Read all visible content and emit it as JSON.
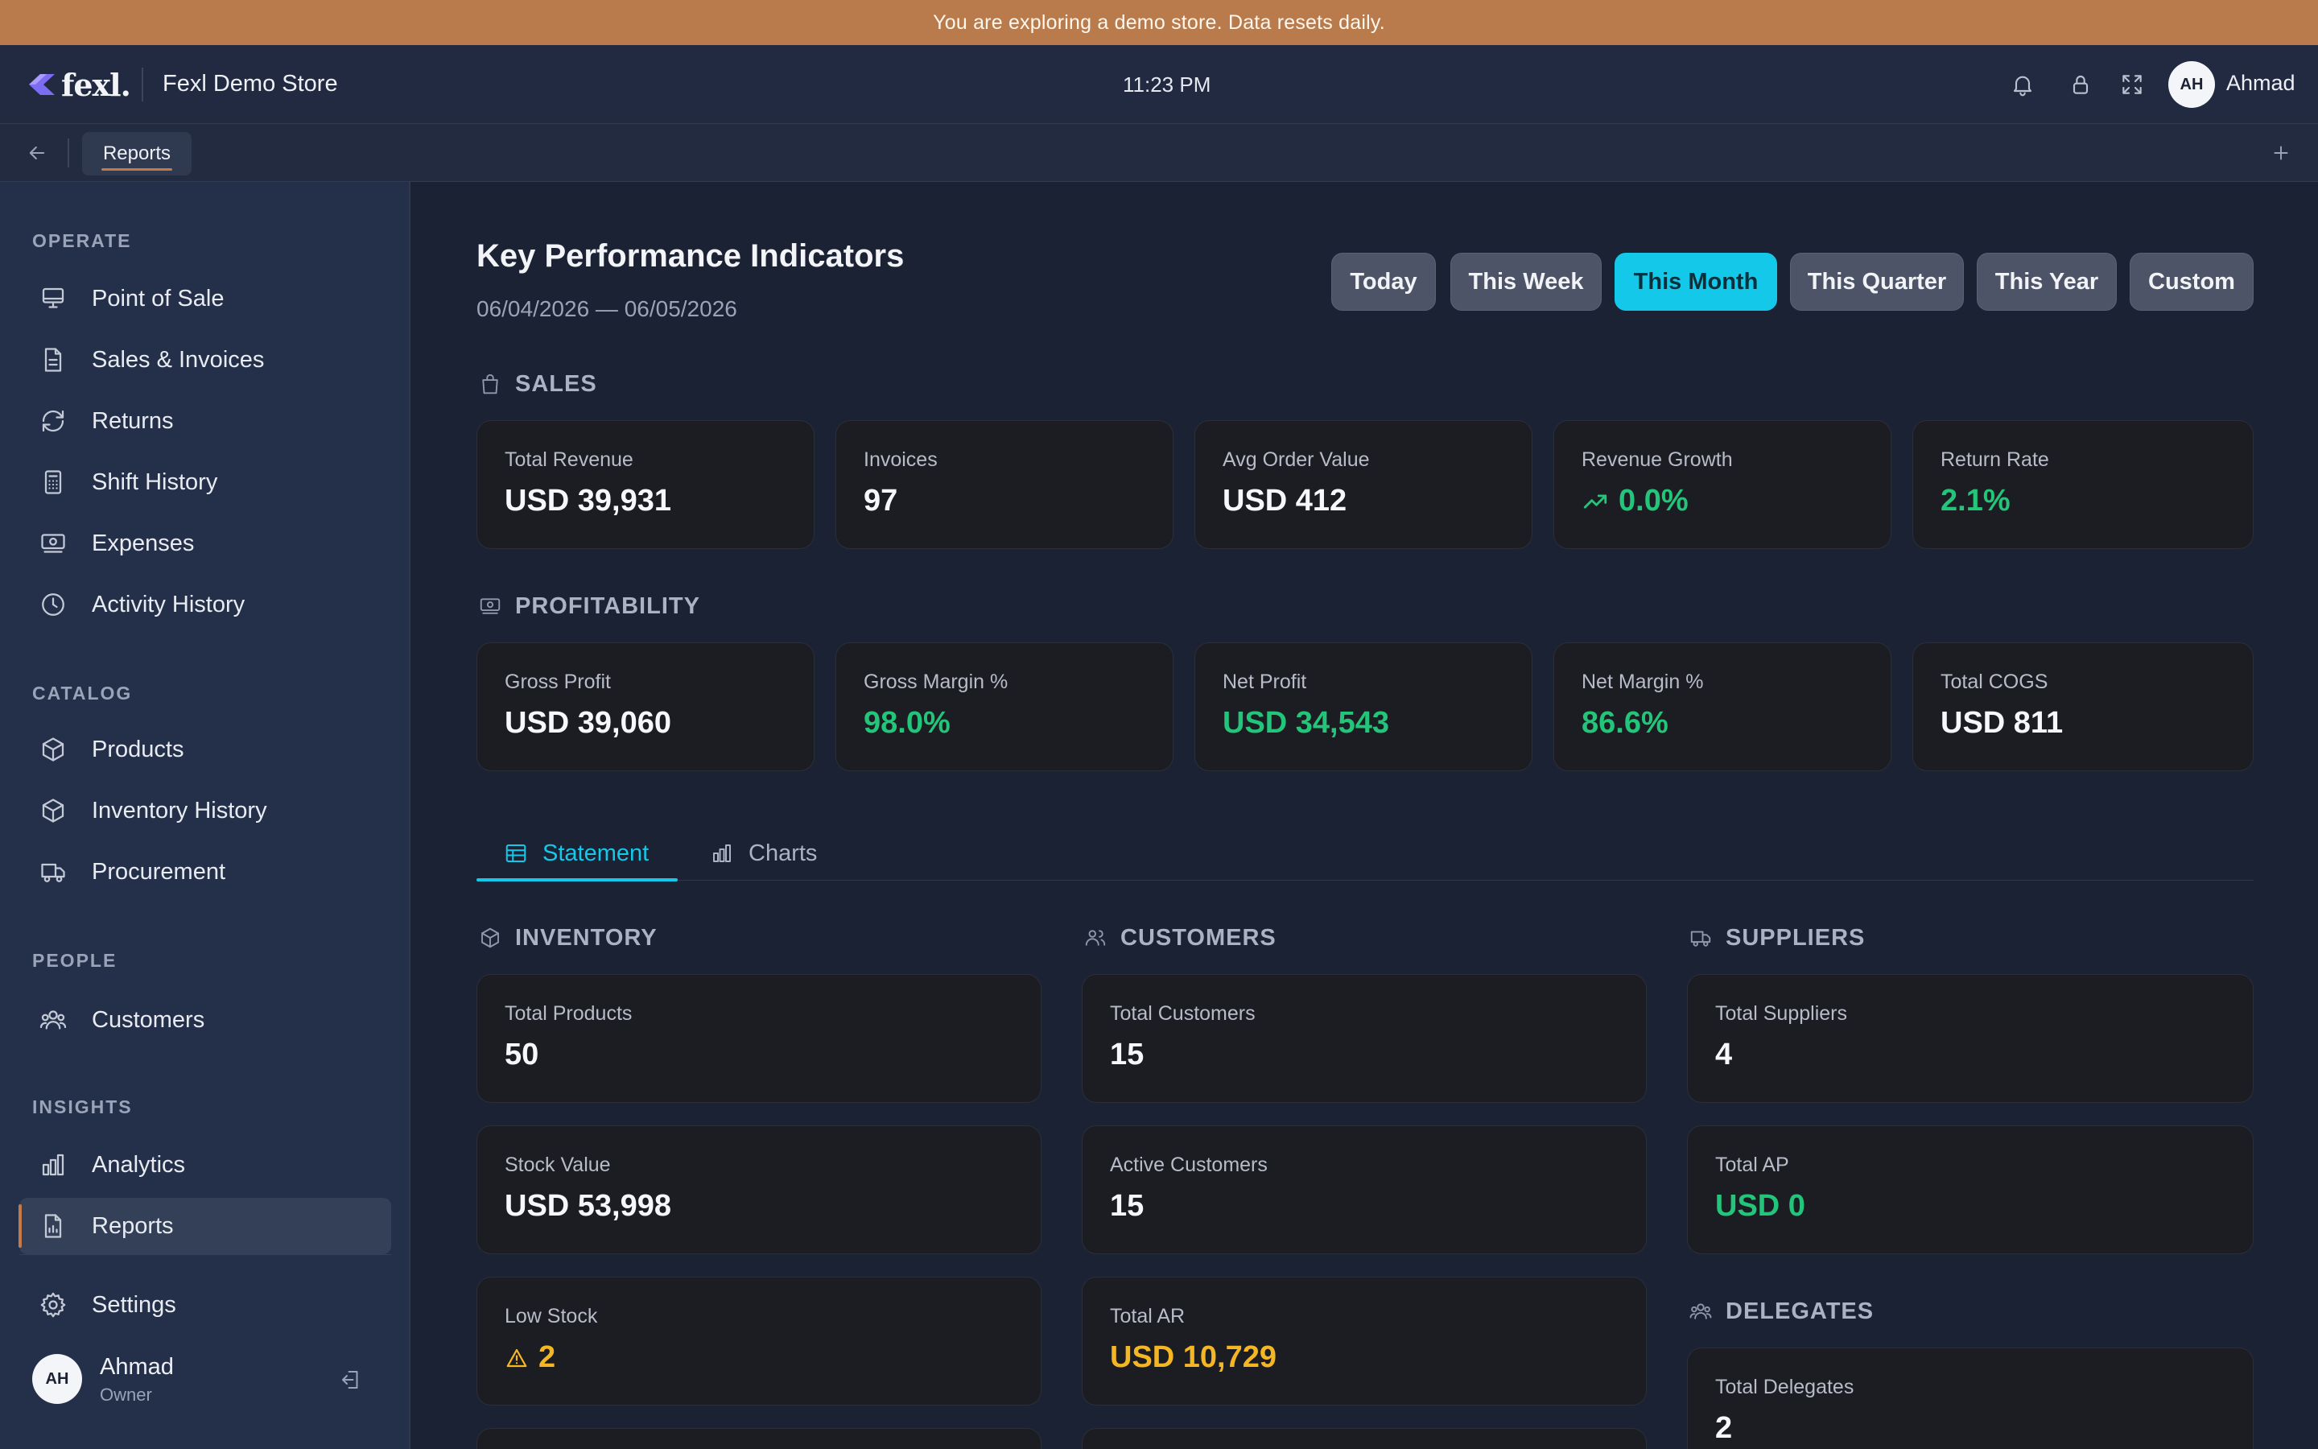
{
  "banner": {
    "text": "You are exploring a demo store. Data resets daily."
  },
  "header": {
    "logo_text": "fexl.",
    "store_name": "Fexl Demo Store",
    "time": "11:23 PM",
    "avatar_initials": "AH",
    "user_name": "Ahmad"
  },
  "tabbar": {
    "active_tab": "Reports"
  },
  "sidebar": {
    "sections": {
      "operate": "OPERATE",
      "catalog": "CATALOG",
      "people": "PEOPLE",
      "insights": "INSIGHTS"
    },
    "items": {
      "pos": "Point of Sale",
      "sales": "Sales & Invoices",
      "returns": "Returns",
      "shift": "Shift History",
      "expenses": "Expenses",
      "activity": "Activity History",
      "products": "Products",
      "inventory": "Inventory History",
      "procurement": "Procurement",
      "customers": "Customers",
      "analytics": "Analytics",
      "reports": "Reports",
      "settings": "Settings"
    },
    "user": {
      "initials": "AH",
      "name": "Ahmad",
      "role": "Owner"
    }
  },
  "main": {
    "title": "Key Performance Indicators",
    "date_range": "06/04/2026 — 06/05/2026",
    "ranges": [
      "Today",
      "This Week",
      "This Month",
      "This Quarter",
      "This Year",
      "Custom"
    ],
    "active_range": "This Month",
    "sales": {
      "label": "SALES",
      "cards": [
        {
          "label": "Total Revenue",
          "value": "USD 39,931"
        },
        {
          "label": "Invoices",
          "value": "97"
        },
        {
          "label": "Avg Order Value",
          "value": "USD 412"
        },
        {
          "label": "Revenue Growth",
          "value": "0.0%"
        },
        {
          "label": "Return Rate",
          "value": "2.1%"
        }
      ]
    },
    "profitability": {
      "label": "PROFITABILITY",
      "cards": [
        {
          "label": "Gross Profit",
          "value": "USD 39,060"
        },
        {
          "label": "Gross Margin %",
          "value": "98.0%"
        },
        {
          "label": "Net Profit",
          "value": "USD 34,543"
        },
        {
          "label": "Net Margin %",
          "value": "86.6%"
        },
        {
          "label": "Total COGS",
          "value": "USD 811"
        }
      ]
    },
    "tabs": {
      "statement": "Statement",
      "charts": "Charts"
    },
    "inventory": {
      "label": "INVENTORY",
      "cards": [
        {
          "label": "Total Products",
          "value": "50"
        },
        {
          "label": "Stock Value",
          "value": "USD 53,998"
        },
        {
          "label": "Low Stock",
          "value": "2"
        }
      ]
    },
    "customers": {
      "label": "CUSTOMERS",
      "cards": [
        {
          "label": "Total Customers",
          "value": "15"
        },
        {
          "label": "Active Customers",
          "value": "15"
        },
        {
          "label": "Total AR",
          "value": "USD 10,729"
        }
      ]
    },
    "suppliers": {
      "label": "SUPPLIERS",
      "cards": [
        {
          "label": "Total Suppliers",
          "value": "4"
        },
        {
          "label": "Total AP",
          "value": "USD 0"
        }
      ]
    },
    "delegates": {
      "label": "DELEGATES",
      "cards": [
        {
          "label": "Total Delegates",
          "value": "2"
        }
      ]
    }
  },
  "colors": {
    "accent": "#14c8ea",
    "positive": "#22c57a",
    "warning": "#f4b622",
    "brand_orange": "#c37a47"
  }
}
